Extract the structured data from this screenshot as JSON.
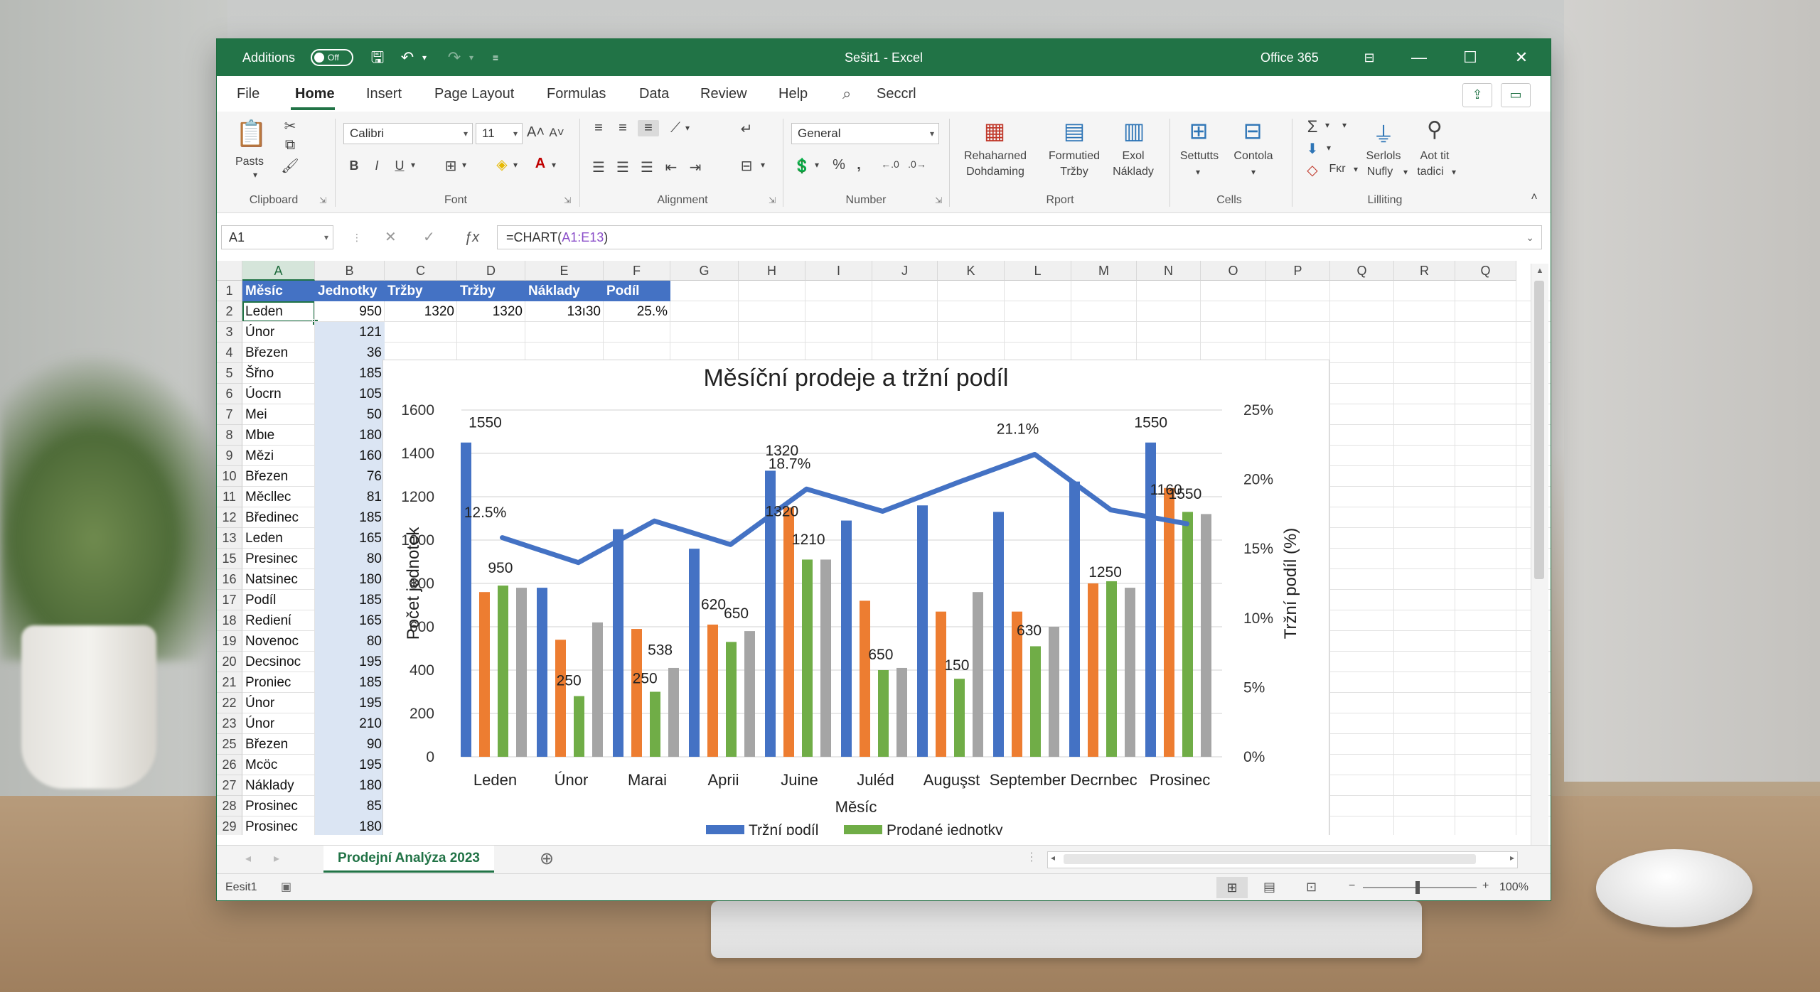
{
  "window": {
    "title": "Sešit1  -  Excel",
    "suite": "Office 365",
    "additions_label": "Additions",
    "toggle_state": "Off"
  },
  "menu": {
    "tabs": [
      "File",
      "Home",
      "Insert",
      "Page Layout",
      "Formulas",
      "Data",
      "Review",
      "Help"
    ],
    "search": "Seccrl"
  },
  "ribbon": {
    "clipboard": {
      "paste": "Pasts",
      "label": "Clipboard"
    },
    "font": {
      "name": "Calibri",
      "size": "11",
      "label": "Font"
    },
    "alignment": {
      "label": "Alignment"
    },
    "number": {
      "format": "General",
      "label": "Number"
    },
    "rport": {
      "btn1_l1": "Rehahaɾned",
      "btn1_l2": "Dohdaming",
      "btn2_l1": "Formutied",
      "btn2_l2": "Tržby",
      "btn3_l1": "Exol",
      "btn3_l2": "Náklady",
      "label": "Rport"
    },
    "cells": {
      "btn1": "Settutts",
      "btn2": "Contola",
      "label": "Cells"
    },
    "editing": {
      "fill_label": "Fκr",
      "sort_l1": "Serlols",
      "sort_l2": "Nufly",
      "find_l1": "Aot tit",
      "find_l2": "tadici",
      "label": "Lilliting"
    }
  },
  "formula_bar": {
    "name_box": "A1",
    "formula_prefix": "=CHART(",
    "formula_ref": "A1:E13",
    "formula_suffix": ")"
  },
  "grid": {
    "columns": [
      "A",
      "B",
      "C",
      "D",
      "E",
      "F",
      "G",
      "H",
      "I",
      "J",
      "K",
      "L",
      "M",
      "N",
      "O",
      "P",
      "Q",
      "R",
      "Q"
    ],
    "row_numbers": [
      "1",
      "2",
      "3",
      "4",
      "5",
      "6",
      "7",
      "8",
      "9",
      "10",
      "11",
      "12",
      "13",
      "15",
      "16",
      "17",
      "18",
      "19",
      "20",
      "21",
      "22",
      "23",
      "25",
      "26",
      "27",
      "28",
      "29"
    ],
    "headers": [
      "Měsíc",
      "Jednotky",
      "Tržby",
      "Tržby",
      "Náklady",
      "Podíl"
    ],
    "row2": [
      "Leden",
      "950",
      "1320",
      "1320",
      "13ı30",
      "25.%"
    ],
    "rows": [
      [
        "Únor",
        "121"
      ],
      [
        "Březen",
        "36"
      ],
      [
        "Šřno",
        "185"
      ],
      [
        "Úocrn",
        "105"
      ],
      [
        "Mei",
        "50"
      ],
      [
        "Mbιe",
        "180"
      ],
      [
        "Mězi",
        "160"
      ],
      [
        "Březen",
        "76"
      ],
      [
        "Měcllec",
        "81"
      ],
      [
        "Bředinec",
        "185"
      ],
      [
        "Leden",
        "165"
      ],
      [
        "Presinec",
        "80"
      ],
      [
        "Natsinec",
        "180"
      ],
      [
        "Podíl",
        "185"
      ],
      [
        "Redienί",
        "165"
      ],
      [
        "Novenoc",
        "80"
      ],
      [
        "Decsinoc",
        "195"
      ],
      [
        "Proniec",
        "185"
      ],
      [
        "Únor",
        "195"
      ],
      [
        "Únor",
        "210"
      ],
      [
        "Březen",
        "90"
      ],
      [
        "Mcöc",
        "195"
      ],
      [
        "Náklady",
        "180"
      ],
      [
        "Prosinec",
        "85"
      ],
      [
        "Prosinec",
        "180"
      ]
    ]
  },
  "chart_data": {
    "type": "bar",
    "title": "Měsíční prodeje a tržní podíl",
    "xlabel": "Měsíc",
    "ylabel": "Počet jednotek",
    "y2label": "Tržní podíl (%)",
    "categories": [
      "Leden",
      "Únor",
      "Marai",
      "Aprii",
      "Juine",
      "Juléd",
      "Auguşst",
      "September",
      "Decrnbec",
      "Prosinec"
    ],
    "ylim": [
      0,
      1600
    ],
    "yticks": [
      "0",
      "200",
      "400",
      "600",
      "800",
      "1000",
      "1200",
      "1400",
      "1600"
    ],
    "y2lim": [
      0,
      25
    ],
    "y2ticks": [
      "0%",
      "5%",
      "10%",
      "15%",
      "20%",
      "25%"
    ],
    "legend": [
      "Tržní podíl",
      "Prodané jednotky"
    ],
    "legend_position": "bottom",
    "grid": true,
    "series": [
      {
        "color": "#4472c4",
        "values": [
          1450,
          780,
          1050,
          960,
          1320,
          1090,
          1160,
          1130,
          1270,
          1450
        ]
      },
      {
        "color": "#ed7d31",
        "values": [
          760,
          540,
          590,
          610,
          1150,
          720,
          670,
          670,
          800,
          1240
        ]
      },
      {
        "color": "#70ad47",
        "values": [
          790,
          280,
          300,
          530,
          910,
          400,
          360,
          510,
          810,
          1130
        ]
      },
      {
        "color": "#a5a5a5",
        "values": [
          780,
          620,
          410,
          580,
          910,
          410,
          760,
          600,
          780,
          1120
        ]
      }
    ],
    "line": {
      "color": "#4472c4",
      "values": [
        15.8,
        14.0,
        17.0,
        15.3,
        19.3,
        17.7,
        19.8,
        21.8,
        17.8,
        16.8
      ]
    },
    "annotations": [
      {
        "text": "1550",
        "x": 0,
        "y": 1520,
        "axis": "y"
      },
      {
        "text": "12.5%",
        "x": 0,
        "y": 1105,
        "axis": "y"
      },
      {
        "text": "950",
        "x": 0.2,
        "y": 850,
        "axis": "y"
      },
      {
        "text": "250",
        "x": 1.1,
        "y": 330,
        "axis": "y"
      },
      {
        "text": "538",
        "x": 2.3,
        "y": 470,
        "axis": "y"
      },
      {
        "text": "250",
        "x": 2.1,
        "y": 340,
        "axis": "y"
      },
      {
        "text": "620",
        "x": 3.0,
        "y": 680,
        "axis": "y"
      },
      {
        "text": "650",
        "x": 3.3,
        "y": 640,
        "axis": "y"
      },
      {
        "text": "1320",
        "x": 3.9,
        "y": 1390,
        "axis": "y"
      },
      {
        "text": "18.7%",
        "x": 4.0,
        "y": 1330,
        "axis": "y"
      },
      {
        "text": "1320",
        "x": 3.9,
        "y": 1110,
        "axis": "y"
      },
      {
        "text": "1210",
        "x": 4.25,
        "y": 980,
        "axis": "y"
      },
      {
        "text": "650",
        "x": 5.2,
        "y": 450,
        "axis": "y"
      },
      {
        "text": "150",
        "x": 6.2,
        "y": 400,
        "axis": "y"
      },
      {
        "text": "21.1%",
        "x": 7.0,
        "y": 1490,
        "axis": "y"
      },
      {
        "text": "630",
        "x": 7.15,
        "y": 560,
        "axis": "y"
      },
      {
        "text": "1250",
        "x": 8.15,
        "y": 830,
        "axis": "y"
      },
      {
        "text": "1550",
        "x": 8.75,
        "y": 1520,
        "axis": "y"
      },
      {
        "text": "1160",
        "x": 8.95,
        "y": 1210,
        "axis": "y"
      },
      {
        "text": "1550",
        "x": 9.2,
        "y": 1190,
        "axis": "y"
      }
    ]
  },
  "sheets": {
    "active": "Prodejní Analýza 2023"
  },
  "status": {
    "left": "Eesit1",
    "zoom": "100%"
  }
}
